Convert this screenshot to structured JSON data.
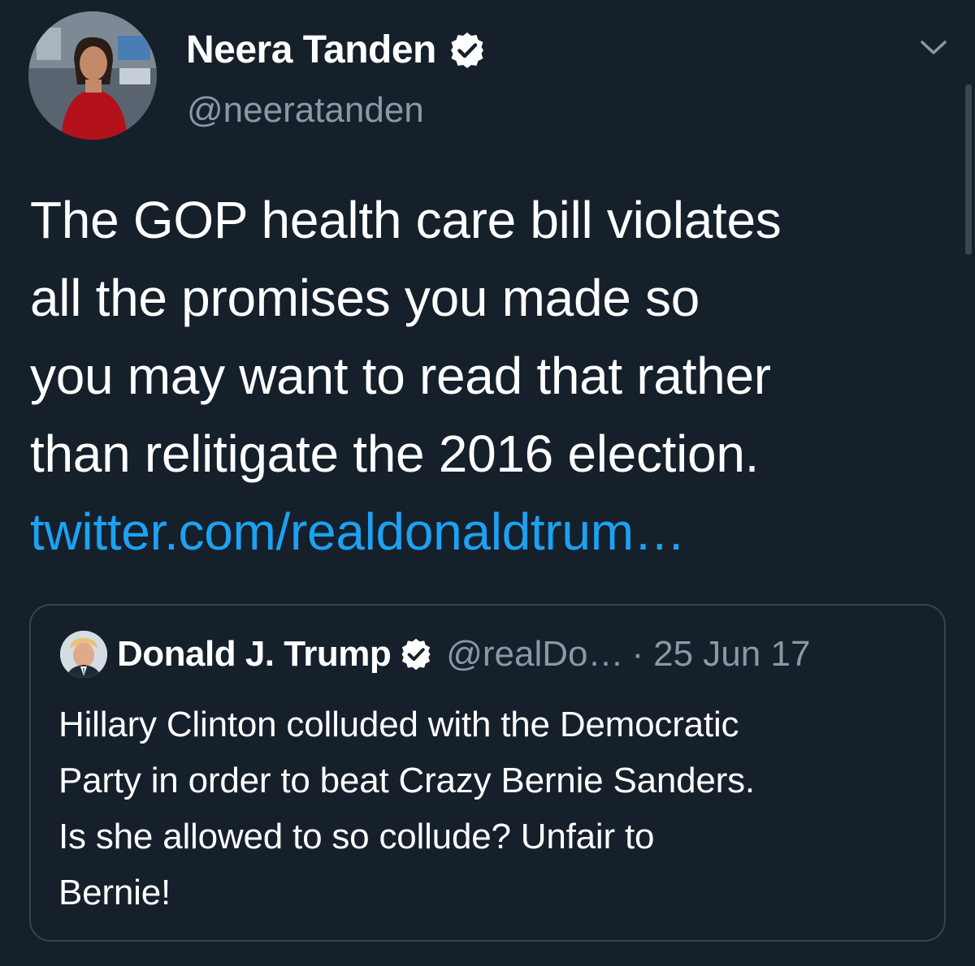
{
  "tweet": {
    "author": {
      "name": "Neera Tanden",
      "handle": "@neeratanden",
      "verified": true,
      "avatar_icon": "profile-photo"
    },
    "text_lines": [
      "The GOP health care bill violates",
      "all the promises you made so",
      "you may want to read that rather",
      "than relitigate the 2016 election."
    ],
    "link_text": "twitter.com/realdonaldtrum…",
    "menu_icon": "chevron-down-icon"
  },
  "quoted_tweet": {
    "author": {
      "name": "Donald J. Trump",
      "handle": "@realDo…",
      "verified": true,
      "avatar_icon": "profile-photo"
    },
    "separator": "·",
    "date": "25 Jun 17",
    "text_lines": [
      "Hillary Clinton colluded with the Democratic",
      "Party in order to beat Crazy Bernie Sanders.",
      "Is she allowed to so collude? Unfair to",
      "Bernie!"
    ]
  },
  "colors": {
    "background": "#15202b",
    "text_primary": "#ffffff",
    "text_secondary": "#8899a6",
    "link": "#1da1f2",
    "border": "#38444d"
  }
}
